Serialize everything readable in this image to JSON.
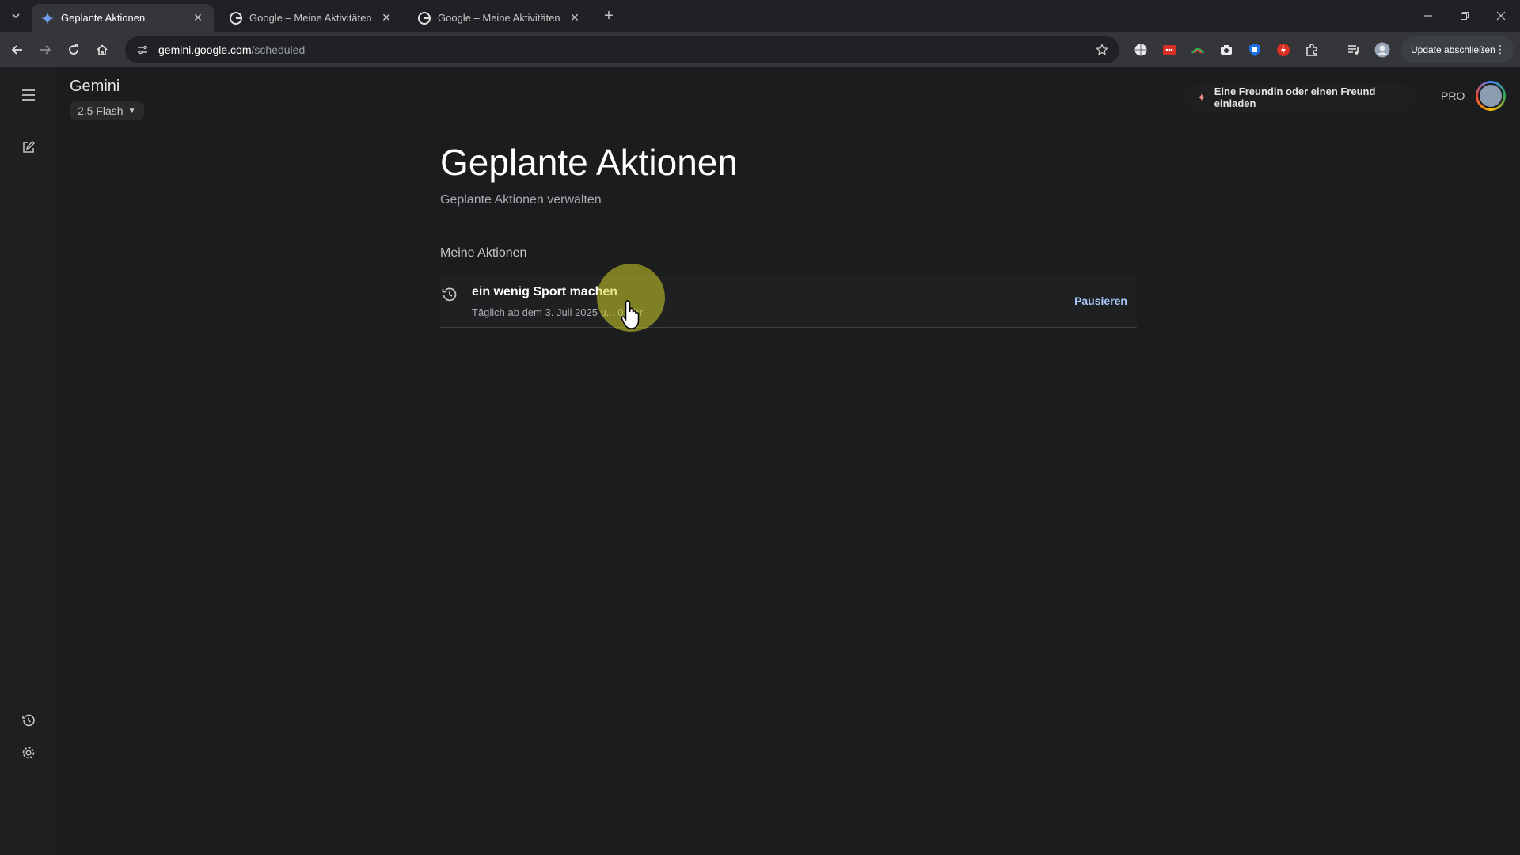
{
  "browser": {
    "tabs": [
      {
        "title": "Geplante Aktionen",
        "active": true,
        "icon": "gemini-sparkle-icon"
      },
      {
        "title": "Google – Meine Aktivitäten",
        "active": false,
        "icon": "google-g-icon"
      },
      {
        "title": "Google – Meine Aktivitäten",
        "active": false,
        "icon": "google-g-icon"
      }
    ],
    "new_tab_label": "+",
    "url_host": "gemini.google.com",
    "url_path": "/scheduled",
    "update_button": "Update abschließen"
  },
  "app": {
    "title": "Gemini",
    "model": "2.5 Flash",
    "invite_label": "Eine Freundin oder einen Freund einladen",
    "pro_badge": "PRO"
  },
  "page": {
    "heading": "Geplante Aktionen",
    "subheading": "Geplante Aktionen verwalten",
    "section": "Meine Aktionen",
    "actions": [
      {
        "title": "ein wenig Sport machen",
        "schedule": "Täglich ab dem 3. Juli 2025 u... 0 Uhr",
        "pause_label": "Pausieren"
      }
    ]
  },
  "colors": {
    "background": "#1b1c1d",
    "accent_link": "#a8c7fa",
    "invite_spark": "#f28b82"
  }
}
